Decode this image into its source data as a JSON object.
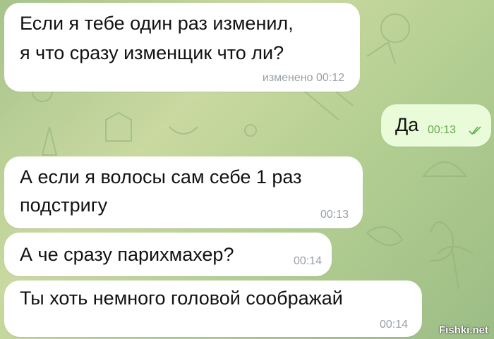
{
  "messages": [
    {
      "id": "m1",
      "lines": [
        "Если я тебе один раз изменил,",
        "я что сразу изменщик что ли?"
      ],
      "meta": "изменено 00:12",
      "direction": "incoming"
    },
    {
      "id": "m2",
      "lines": [
        "Да"
      ],
      "meta": "00:13",
      "direction": "outgoing",
      "status_icon": "double-check-icon"
    },
    {
      "id": "m3",
      "lines": [
        "А если я волосы сам себе 1 раз",
        "подстригу"
      ],
      "meta": "00:13",
      "direction": "incoming"
    },
    {
      "id": "m4",
      "lines": [
        "А че сразу парихмахер?"
      ],
      "meta": "00:14",
      "direction": "incoming"
    },
    {
      "id": "m5",
      "lines": [
        "Ты хоть немного головой соображай"
      ],
      "meta": "00:14",
      "direction": "incoming"
    }
  ],
  "watermark": "Fishki.net",
  "colors": {
    "incoming_bubble": "#ffffff",
    "outgoing_bubble": "#e9fbd8",
    "outgoing_meta": "#5fae4e",
    "incoming_meta": "#9aa0a6",
    "background": "#b5cf92"
  }
}
